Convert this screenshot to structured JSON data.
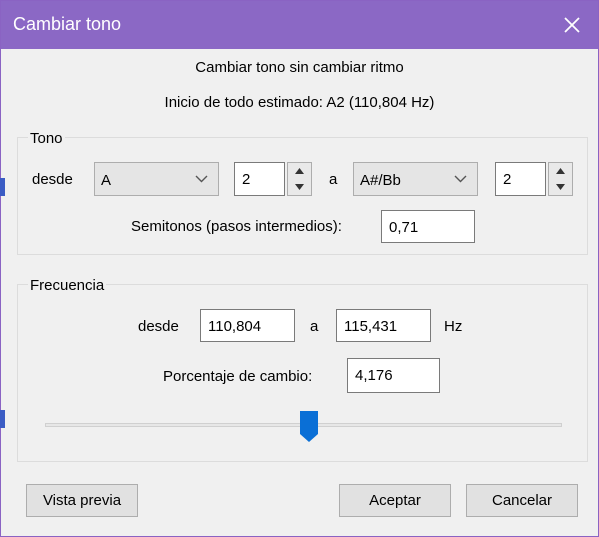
{
  "window": {
    "title": "Cambiar tono",
    "close_icon": "close-icon",
    "title_bar_color": "#8b68c5"
  },
  "header": {
    "subtitle": "Cambiar tono sin cambiar ritmo",
    "estimated_start": "Inicio de todo estimado: A2 (110,804 Hz)"
  },
  "tono": {
    "group_label": "Tono",
    "from_label": "desde",
    "from_note": "A",
    "from_octave": "2",
    "to_label": "a",
    "to_note": "A#/Bb",
    "to_octave": "2",
    "semitones_label": "Semitonos (pasos intermedios):",
    "semitones_value": "0,71"
  },
  "frecuencia": {
    "group_label": "Frecuencia",
    "from_label": "desde",
    "from_value": "110,804",
    "to_label": "a",
    "to_value": "115,431",
    "unit": "Hz",
    "percent_label": "Porcentaje de cambio:",
    "percent_value": "4,176",
    "slider_level": 0.5
  },
  "buttons": {
    "preview": "Vista previa",
    "accept": "Aceptar",
    "cancel": "Cancelar"
  },
  "colors": {
    "accent": "#0078d7",
    "slider_thumb": "#0a6fd6"
  }
}
